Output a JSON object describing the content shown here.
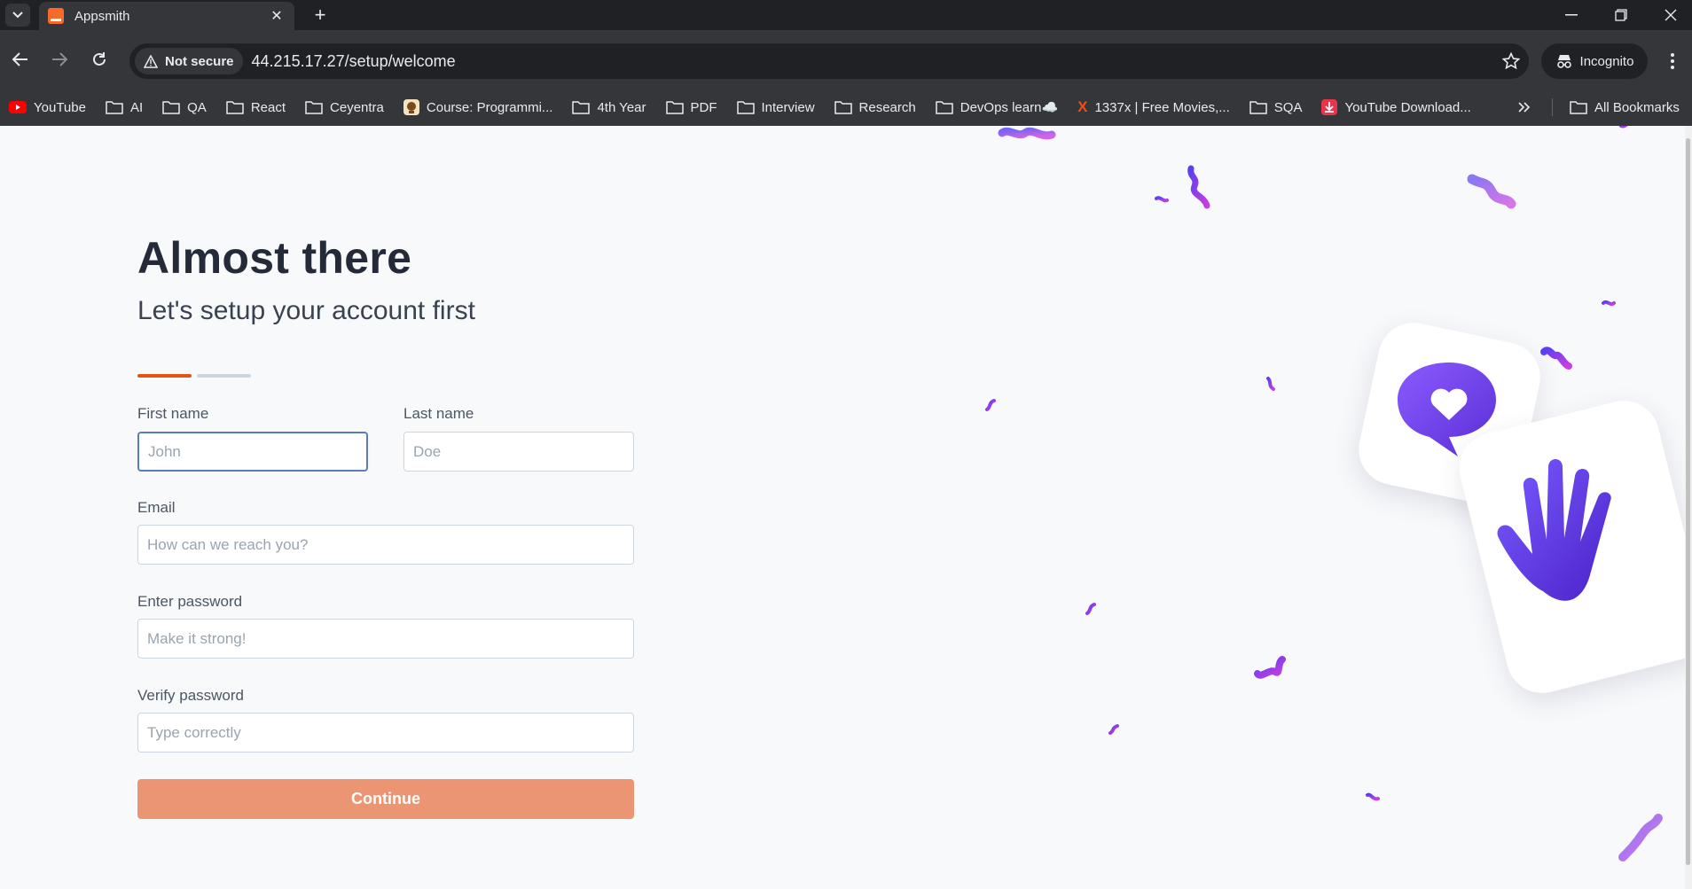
{
  "browser": {
    "tab_title": "Appsmith",
    "security_label": "Not secure",
    "url": "44.215.17.27/setup/welcome",
    "incognito_label": "Incognito",
    "bookmarks": [
      {
        "label": "YouTube",
        "icon": "youtube-icon"
      },
      {
        "label": "AI",
        "icon": "folder-icon"
      },
      {
        "label": "QA",
        "icon": "folder-icon"
      },
      {
        "label": "React",
        "icon": "folder-icon"
      },
      {
        "label": "Ceyentra",
        "icon": "folder-icon"
      },
      {
        "label": "Course: Programmi...",
        "icon": "course-icon"
      },
      {
        "label": "4th Year",
        "icon": "folder-icon"
      },
      {
        "label": "PDF",
        "icon": "folder-icon"
      },
      {
        "label": "Interview",
        "icon": "folder-icon"
      },
      {
        "label": "Research",
        "icon": "folder-icon"
      },
      {
        "label": "DevOps learn☁️",
        "icon": "folder-icon"
      },
      {
        "label": "1337x | Free Movies,...",
        "icon": "1337x-icon"
      },
      {
        "label": "SQA",
        "icon": "folder-icon"
      },
      {
        "label": "YouTube Download...",
        "icon": "download-icon"
      }
    ],
    "all_bookmarks_label": "All Bookmarks"
  },
  "form": {
    "title": "Almost there",
    "subtitle": "Let's setup your account first",
    "first_name_label": "First name",
    "first_name_placeholder": "John",
    "last_name_label": "Last name",
    "last_name_placeholder": "Doe",
    "email_label": "Email",
    "email_placeholder": "How can we reach you?",
    "password_label": "Enter password",
    "password_placeholder": "Make it strong!",
    "verify_label": "Verify password",
    "verify_placeholder": "Type correctly",
    "continue_label": "Continue"
  },
  "colors": {
    "accent": "#e15615",
    "button": "#ec9572",
    "confetti_purple": "#7b3fe4"
  }
}
